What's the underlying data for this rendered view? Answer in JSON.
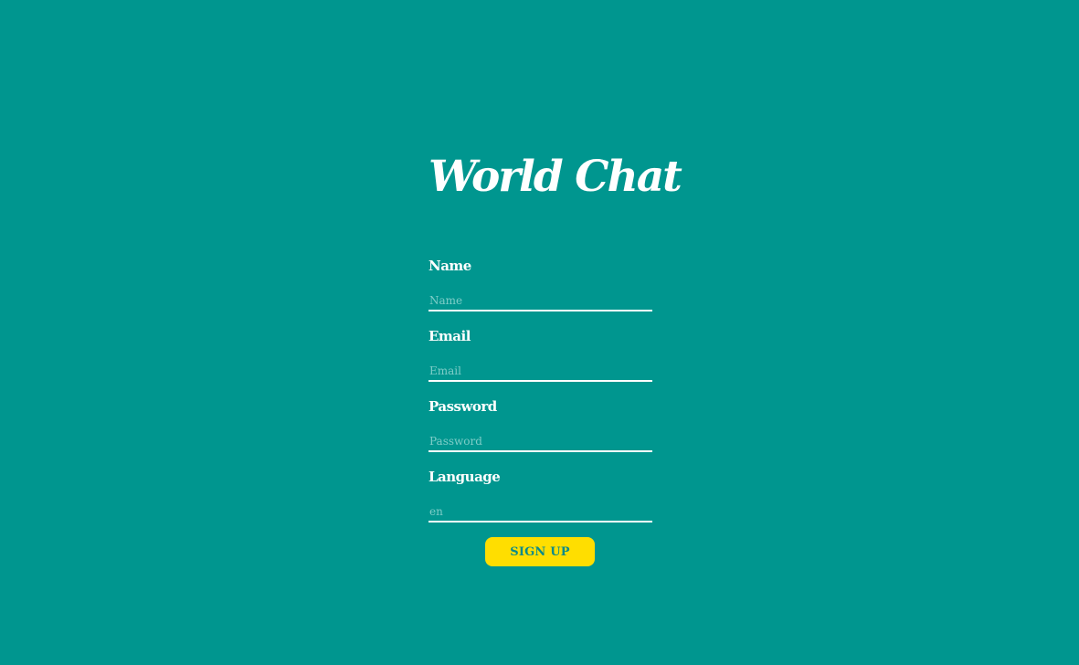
{
  "app": {
    "title": "World Chat"
  },
  "colors": {
    "background": "#00968f",
    "accent_button": "#ffde00",
    "button_text": "#0a8a8a",
    "text": "#ffffff",
    "placeholder": "#7fcdc8"
  },
  "form": {
    "fields": [
      {
        "label": "Name",
        "placeholder": "Name",
        "value": ""
      },
      {
        "label": "Email",
        "placeholder": "Email",
        "value": ""
      },
      {
        "label": "Password",
        "placeholder": "Password",
        "value": ""
      },
      {
        "label": "Language",
        "placeholder": "en",
        "value": ""
      }
    ],
    "submit_label": "SIGN UP"
  }
}
